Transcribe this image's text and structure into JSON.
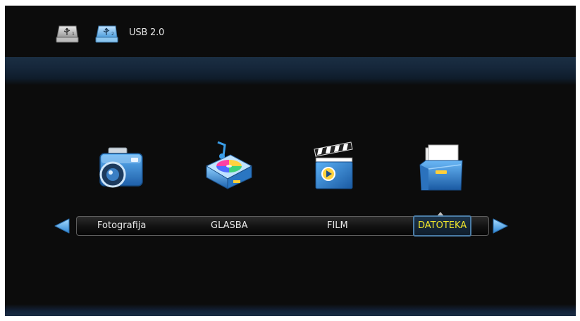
{
  "header": {
    "devices": [
      {
        "icon": "usb-drive-icon",
        "number": "1"
      },
      {
        "icon": "usb-drive-icon",
        "number": "2"
      }
    ],
    "device_label": "USB 2.0"
  },
  "menu": {
    "items": [
      {
        "label": "Fotografija",
        "icon": "camera-icon",
        "selected": false
      },
      {
        "label": "GLASBA",
        "icon": "music-projector-icon",
        "selected": false
      },
      {
        "label": "FILM",
        "icon": "clapperboard-icon",
        "selected": false
      },
      {
        "label": "DATOTEKA",
        "icon": "folder-files-icon",
        "selected": true
      }
    ],
    "nav_icons": [
      "arrow-left-icon",
      "arrow-right-icon"
    ]
  },
  "colors": {
    "background": "#0c0c0c",
    "highlight_text": "#f1e62b",
    "accent_blue": "#3f8fd8",
    "text": "#e8e8e8"
  }
}
